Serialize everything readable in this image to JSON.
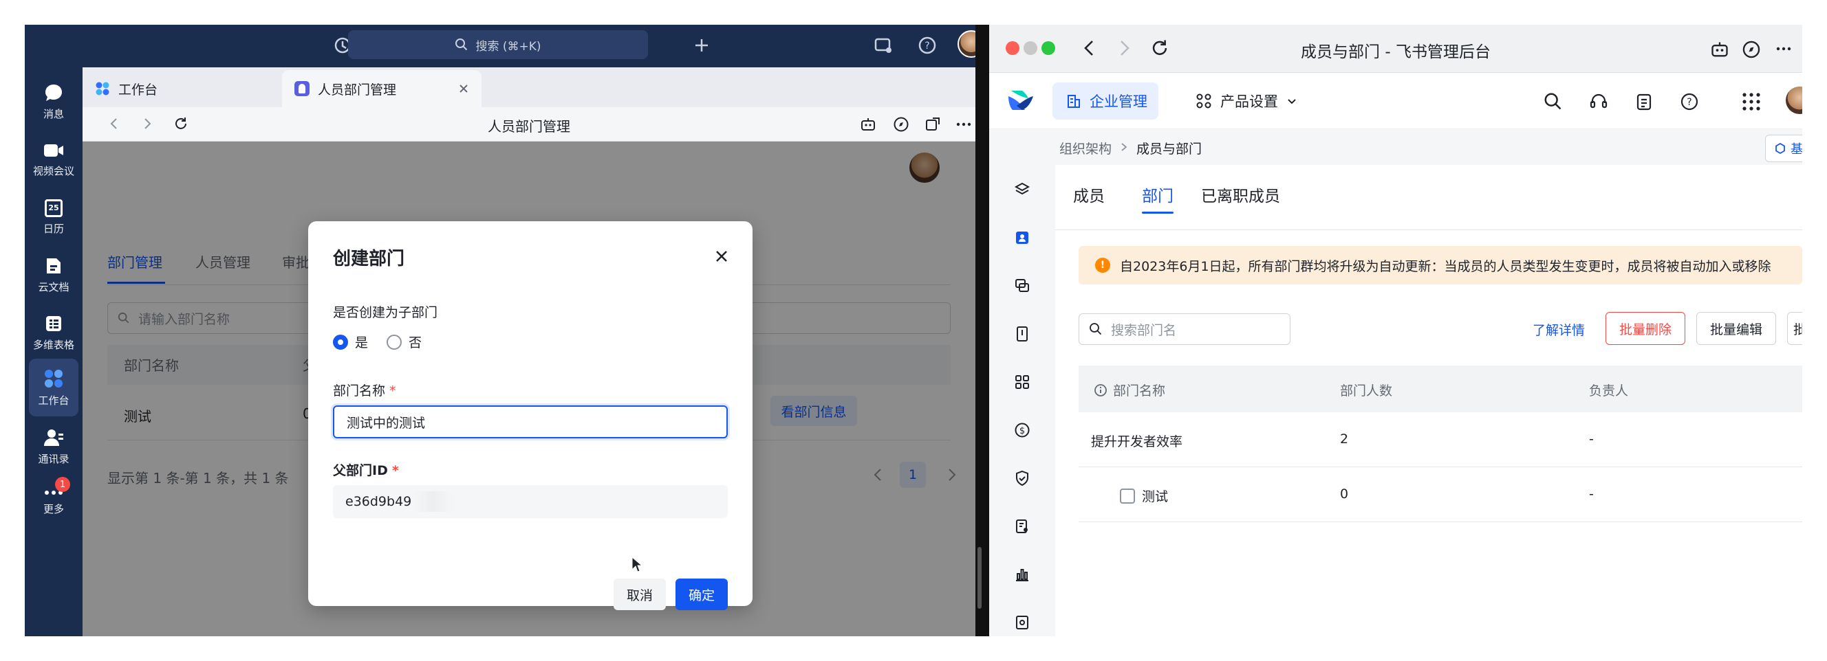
{
  "left_app": {
    "rail": [
      {
        "label": "消息",
        "icon": "message-icon"
      },
      {
        "label": "视频会议",
        "icon": "video-icon"
      },
      {
        "label": "日历",
        "icon": "calendar-icon"
      },
      {
        "label": "云文档",
        "icon": "docs-icon"
      },
      {
        "label": "多维表格",
        "icon": "bitable-icon"
      },
      {
        "label": "工作台",
        "icon": "workplace-icon"
      },
      {
        "label": "通讯录",
        "icon": "contacts-icon"
      },
      {
        "label": "更多",
        "icon": "more-icon"
      }
    ],
    "calendar_day": "25",
    "more_badge": "1",
    "search_placeholder": "搜索 (⌘+K)",
    "tabs": [
      {
        "label": "工作台"
      },
      {
        "label": "人员部门管理"
      }
    ],
    "page_title": "人员部门管理",
    "bg_tabs": [
      "部门管理",
      "人员管理",
      "审批"
    ],
    "bg_search_placeholder": "请输入部门名称",
    "bg_col_headers": [
      "部门名称",
      "父部"
    ],
    "bg_row": {
      "name": "测试",
      "parent": "0",
      "action": "看部门信息"
    },
    "bg_footer": "显示第 1 条-第 1 条，共 1 条",
    "bg_page": "1",
    "dialog": {
      "title": "创建部门",
      "q_sub": "是否创建为子部门",
      "opt_yes": "是",
      "opt_no": "否",
      "name_label": "部门名称",
      "name_value": "测试中的测试",
      "parent_label": "父部门ID",
      "parent_value": "e36d9b49",
      "required": "*",
      "cancel": "取消",
      "ok": "确定"
    }
  },
  "right_app": {
    "window_title": "成员与部门 - 飞书管理后台",
    "enterprise_btn": "企业管理",
    "product_btn": "产品设置",
    "breadcrumb": [
      "组织架构",
      "成员与部门"
    ],
    "corner_btn": "基",
    "tabs": [
      "成员",
      "部门",
      "已离职成员"
    ],
    "notice": "自2023年6月1日起，所有部门群均将升级为自动更新：当成员的人员类型发生变更时，成员将被自动加入或移除",
    "search_placeholder": "搜索部门名",
    "learn_more": "了解详情",
    "batch_delete": "批量删除",
    "batch_edit": "批量编辑",
    "cut_btn": "批",
    "columns": [
      "部门名称",
      "部门人数",
      "负责人"
    ],
    "rows": [
      {
        "name": "提升开发者效率",
        "count": "2",
        "owner": "-"
      },
      {
        "name": "测试",
        "count": "0",
        "owner": "-"
      }
    ]
  },
  "colors": {
    "brand_blue": "#1456f0",
    "danger": "#f54a45",
    "rail_bg": "#1b2d4f",
    "notice_bg": "#fdeddb",
    "notice_icon": "#ff8800"
  }
}
